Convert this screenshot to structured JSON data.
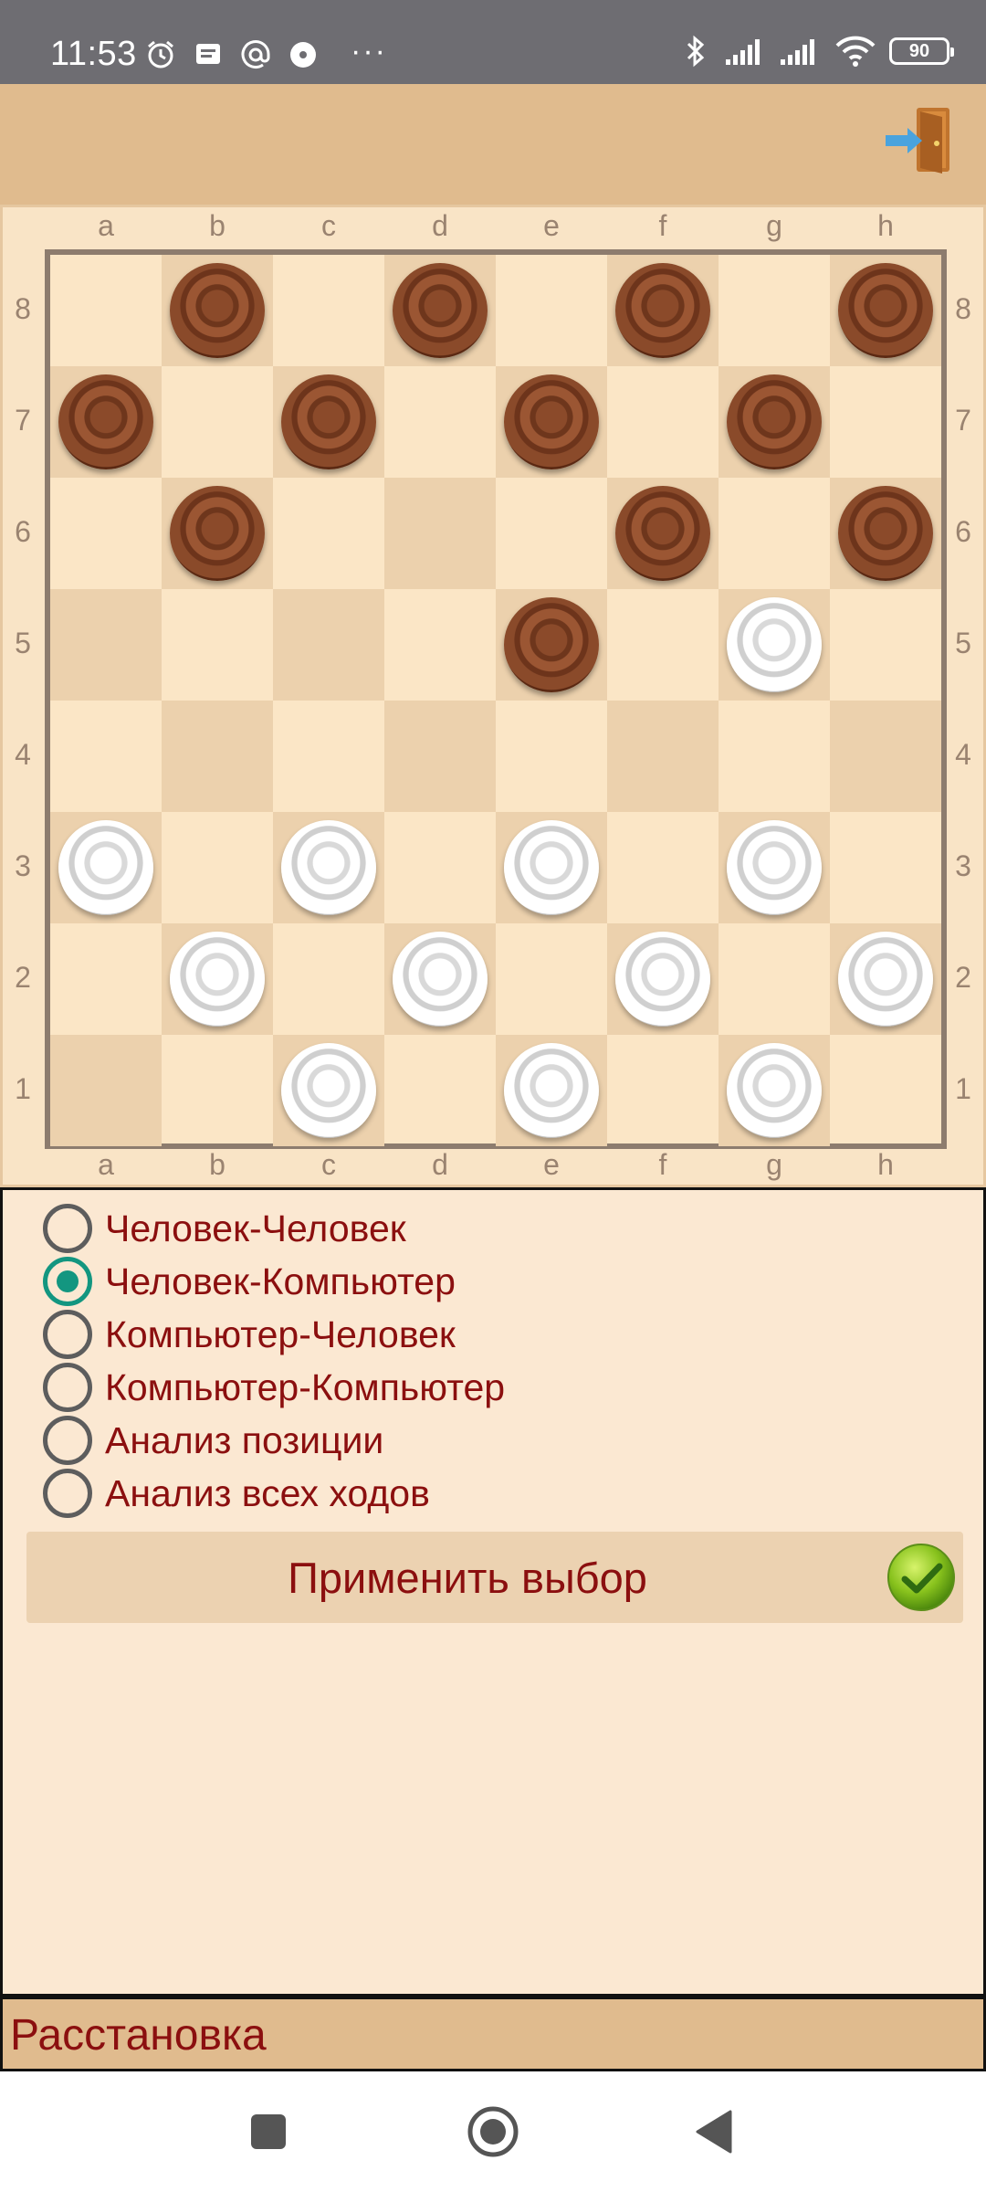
{
  "status_bar": {
    "time": "11:53",
    "battery": "90",
    "left_icons": [
      "alarm-icon",
      "message-icon",
      "at-icon",
      "media-icon"
    ],
    "right_icons": [
      "bluetooth-icon",
      "signal-icon",
      "signal-icon",
      "wifi-icon"
    ]
  },
  "app_bar": {
    "exit_icon": "exit-door-icon"
  },
  "board": {
    "files": [
      "a",
      "b",
      "c",
      "d",
      "e",
      "f",
      "g",
      "h"
    ],
    "ranks": [
      "8",
      "7",
      "6",
      "5",
      "4",
      "3",
      "2",
      "1"
    ],
    "pieces": [
      {
        "square": "b8",
        "color": "black"
      },
      {
        "square": "d8",
        "color": "black"
      },
      {
        "square": "f8",
        "color": "black"
      },
      {
        "square": "h8",
        "color": "black"
      },
      {
        "square": "a7",
        "color": "black"
      },
      {
        "square": "c7",
        "color": "black"
      },
      {
        "square": "e7",
        "color": "black"
      },
      {
        "square": "g7",
        "color": "black"
      },
      {
        "square": "b6",
        "color": "black"
      },
      {
        "square": "f6",
        "color": "black"
      },
      {
        "square": "h6",
        "color": "black"
      },
      {
        "square": "e5",
        "color": "black"
      },
      {
        "square": "g5",
        "color": "white"
      },
      {
        "square": "a3",
        "color": "white"
      },
      {
        "square": "c3",
        "color": "white"
      },
      {
        "square": "e3",
        "color": "white"
      },
      {
        "square": "g3",
        "color": "white"
      },
      {
        "square": "b2",
        "color": "white"
      },
      {
        "square": "d2",
        "color": "white"
      },
      {
        "square": "f2",
        "color": "white"
      },
      {
        "square": "h2",
        "color": "white"
      },
      {
        "square": "c1",
        "color": "white"
      },
      {
        "square": "e1",
        "color": "white"
      },
      {
        "square": "g1",
        "color": "white"
      }
    ],
    "highlighted_squares": [
      "a1",
      "c5",
      "a5",
      "d6",
      "b4",
      "d4",
      "f4",
      "h4"
    ]
  },
  "modes": {
    "options": [
      {
        "label": "Человек-Человек",
        "checked": false
      },
      {
        "label": "Человек-Компьютер",
        "checked": true
      },
      {
        "label": "Компьютер-Человек",
        "checked": false
      },
      {
        "label": "Компьютер-Компьютер",
        "checked": false
      },
      {
        "label": "Анализ позиции",
        "checked": false
      },
      {
        "label": "Анализ всех ходов",
        "checked": false
      }
    ],
    "apply_label": "Применить выбор",
    "apply_icon": "checkmark-icon"
  },
  "info_bar": {
    "label": "Расстановка"
  },
  "nav_bar": {
    "icons": [
      "recents-square-icon",
      "home-circle-icon",
      "back-triangle-icon"
    ]
  }
}
